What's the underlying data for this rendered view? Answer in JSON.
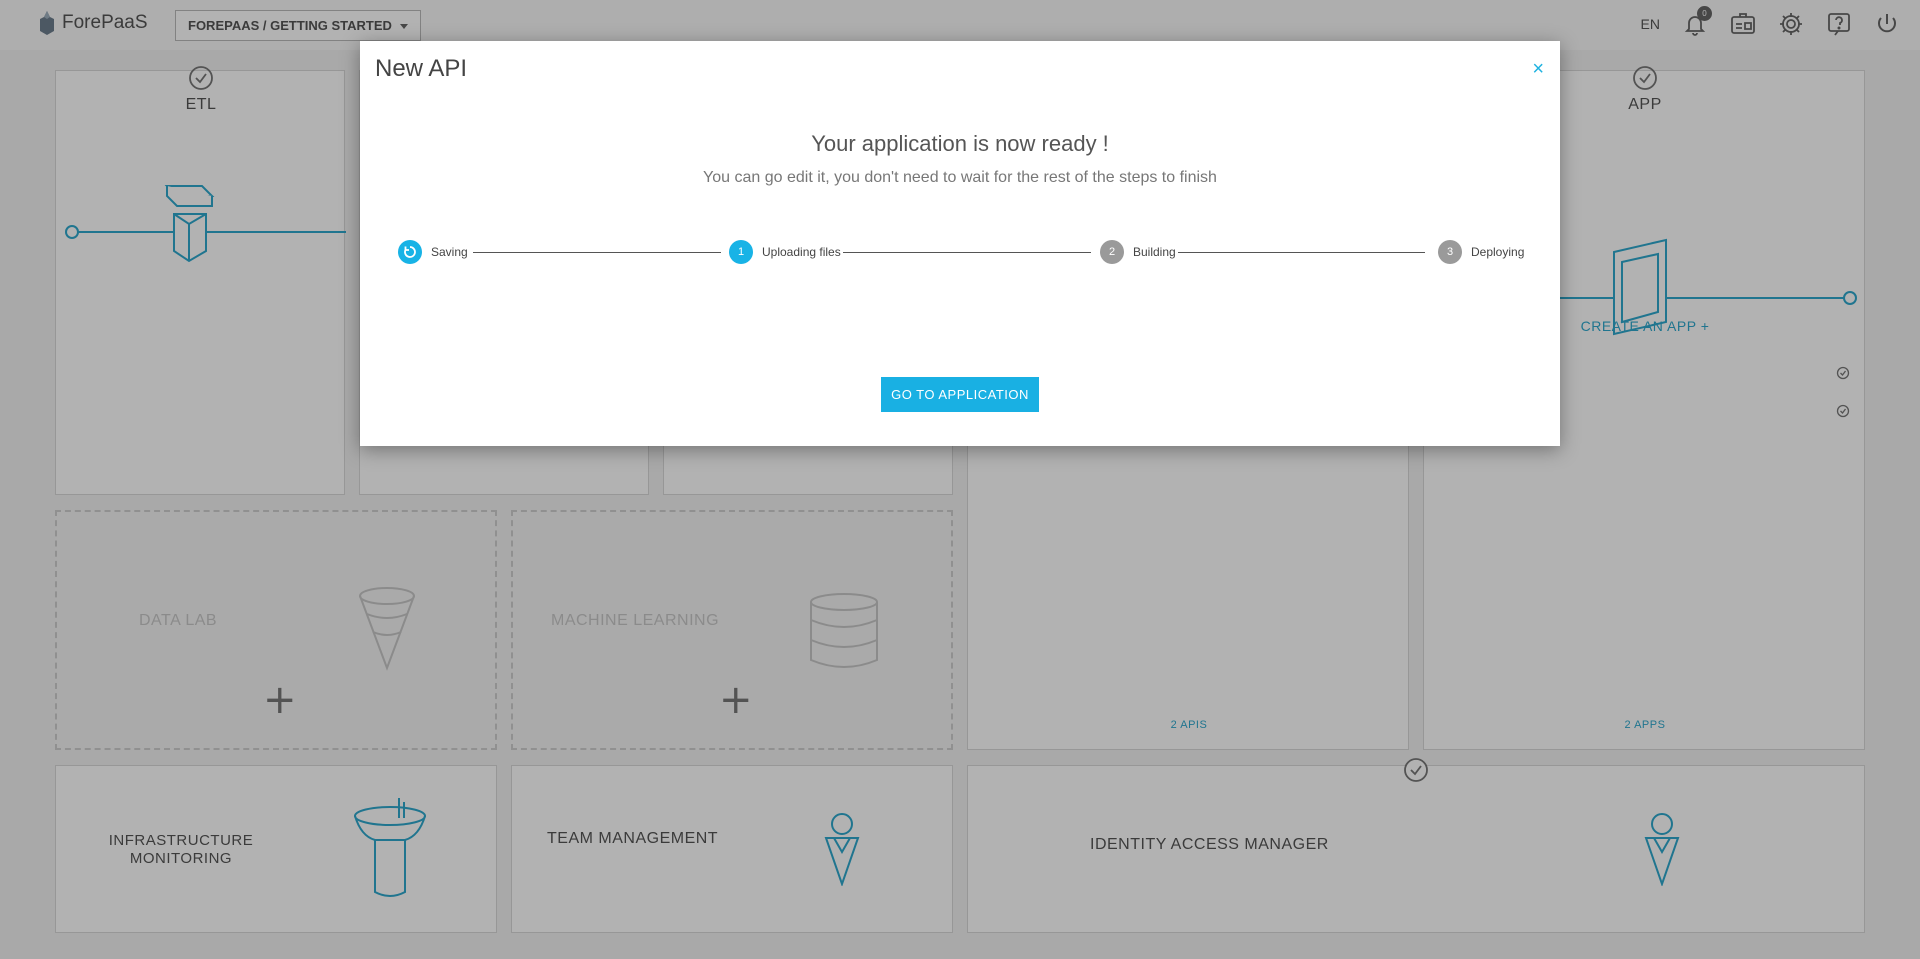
{
  "header": {
    "brand": "ForePaaS",
    "project": "FOREPAAS / GETTING STARTED",
    "lang": "EN",
    "notif_count": "0",
    "icons": [
      "bell-icon",
      "id-card-icon",
      "gear-icon",
      "help-icon",
      "power-icon"
    ]
  },
  "tiles": {
    "etl": {
      "title": "ETL"
    },
    "app": {
      "title": "APP",
      "create": "CREATE AN APP +",
      "count": "2 APPS"
    },
    "api": {
      "count": "2 APIS"
    },
    "data_lab": {
      "title": "DATA LAB"
    },
    "machine_learning": {
      "title": "MACHINE LEARNING"
    },
    "infra": {
      "title": "INFRASTRUCTURE\nMONITORING"
    },
    "team": {
      "title": "TEAM MANAGEMENT"
    },
    "iam": {
      "title": "IDENTITY ACCESS MANAGER"
    }
  },
  "modal": {
    "title": "New API",
    "close": "×",
    "ready_title": "Your application is now ready !",
    "ready_sub": "You can go edit it, you don't need to wait for the rest of the steps to finish",
    "steps": [
      {
        "num": "",
        "label": "Saving",
        "state": "active"
      },
      {
        "num": "1",
        "label": "Uploading files",
        "state": "active"
      },
      {
        "num": "2",
        "label": "Building",
        "state": "idle"
      },
      {
        "num": "3",
        "label": "Deploying",
        "state": "idle"
      }
    ],
    "button": "GO TO APPLICATION"
  },
  "colors": {
    "accent": "#19b0e3",
    "tile_line": "#2fa8cd"
  }
}
